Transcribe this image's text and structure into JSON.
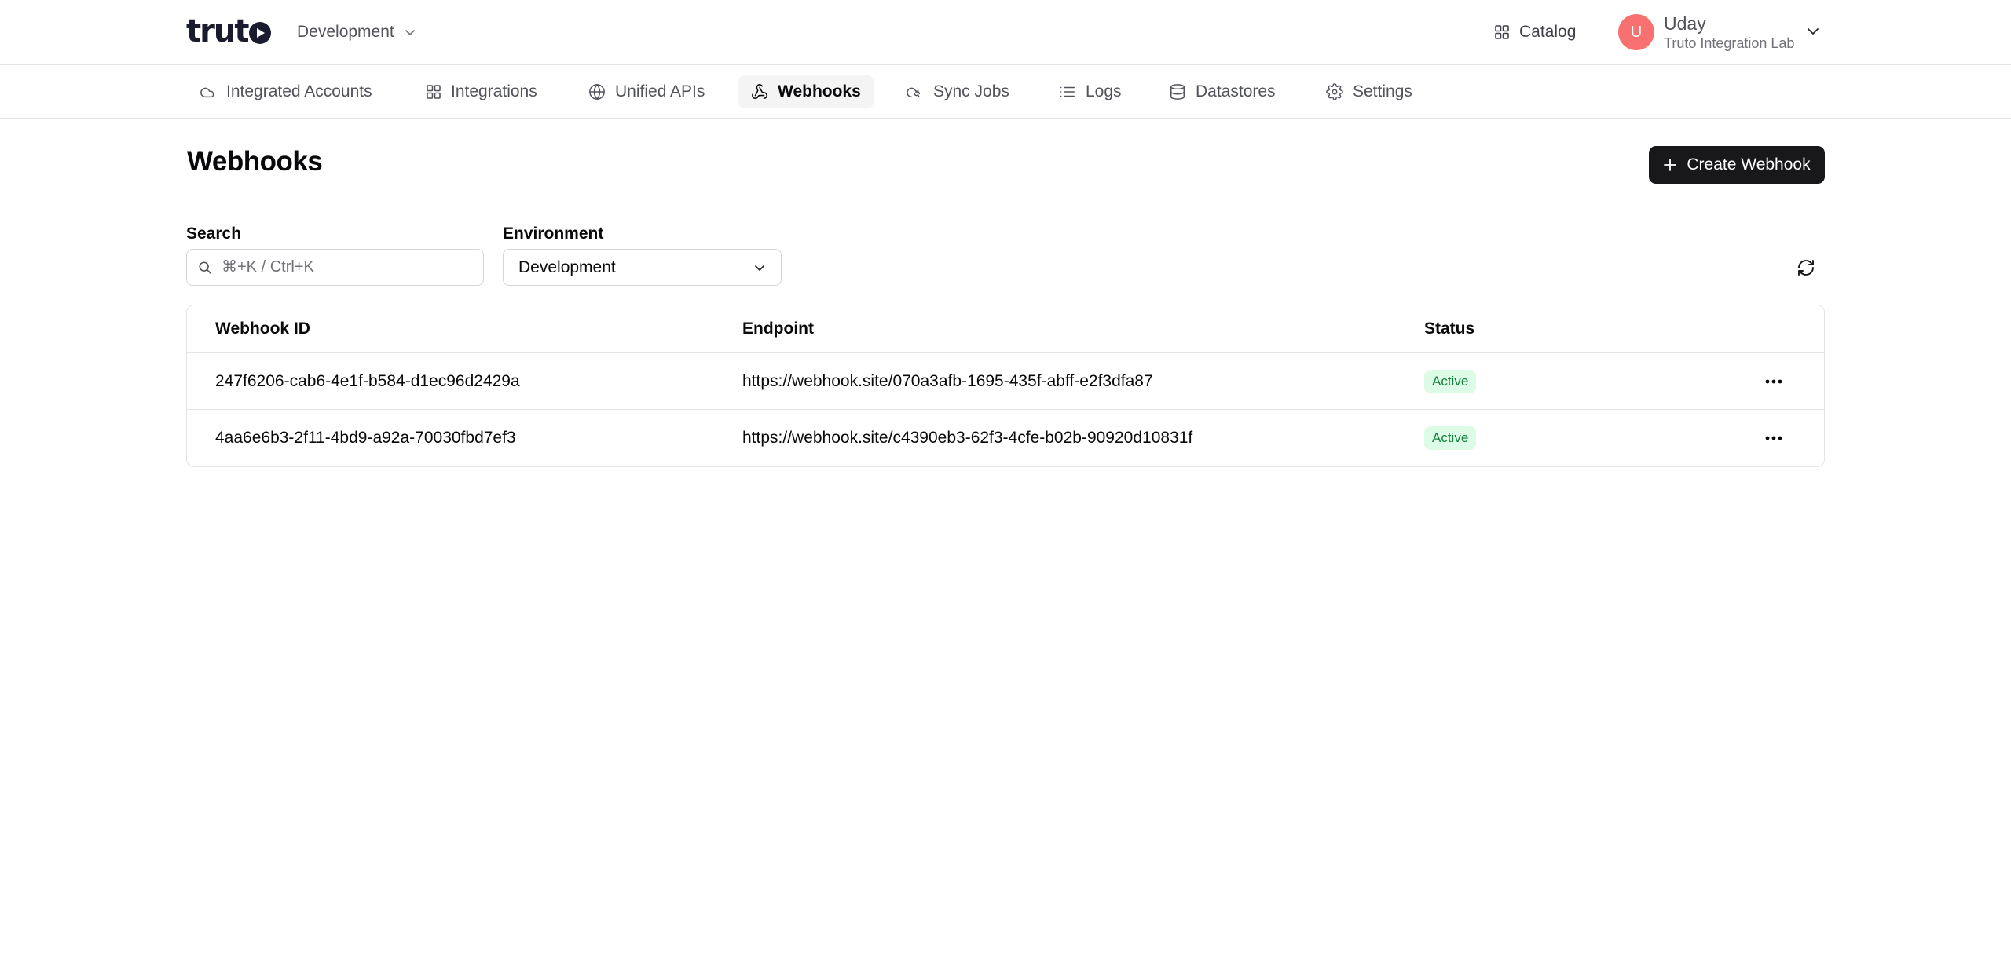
{
  "brand": {
    "logo_text": "trut"
  },
  "header": {
    "environment": "Development",
    "catalog_label": "Catalog",
    "user": {
      "initial": "U",
      "name": "Uday",
      "org": "Truto Integration Lab",
      "avatar_color": "#f87171"
    }
  },
  "nav": {
    "tabs": [
      {
        "label": "Integrated Accounts",
        "icon": "cloud-icon",
        "active": false
      },
      {
        "label": "Integrations",
        "icon": "grid-icon",
        "active": false
      },
      {
        "label": "Unified APIs",
        "icon": "globe-icon",
        "active": false
      },
      {
        "label": "Webhooks",
        "icon": "webhook-icon",
        "active": true
      },
      {
        "label": "Sync Jobs",
        "icon": "cloud-sync-icon",
        "active": false
      },
      {
        "label": "Logs",
        "icon": "list-icon",
        "active": false
      },
      {
        "label": "Datastores",
        "icon": "database-icon",
        "active": false
      },
      {
        "label": "Settings",
        "icon": "gear-icon",
        "active": false
      }
    ]
  },
  "page": {
    "title": "Webhooks",
    "create_button": "Create Webhook"
  },
  "filters": {
    "search_label": "Search",
    "search_placeholder": "⌘+K / Ctrl+K",
    "environment_label": "Environment",
    "environment_value": "Development"
  },
  "table": {
    "columns": [
      "Webhook ID",
      "Endpoint",
      "Status"
    ],
    "rows": [
      {
        "id": "247f6206-cab6-4e1f-b584-d1ec96d2429a",
        "endpoint": "https://webhook.site/070a3afb-1695-435f-abff-e2f3dfa87",
        "status": "Active"
      },
      {
        "id": "4aa6e6b3-2f11-4bd9-a92a-70030fbd7ef3",
        "endpoint": "https://webhook.site/c4390eb3-62f3-4cfe-b02b-90920d10831f",
        "status": "Active"
      }
    ]
  },
  "colors": {
    "primary_button": "#18181b",
    "active_badge_bg": "#dcfce7",
    "active_badge_text": "#15803d",
    "brand_dark": "#1b1b2f"
  }
}
